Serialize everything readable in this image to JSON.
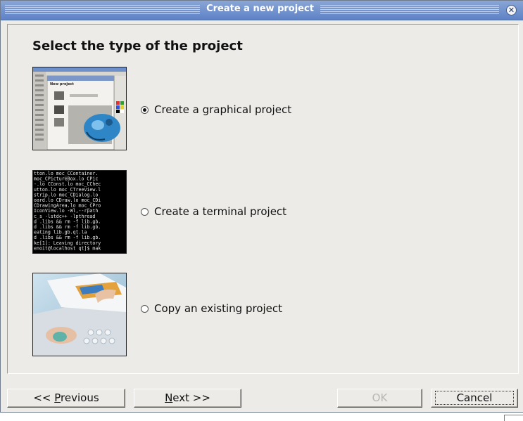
{
  "window": {
    "title": "Create a new project"
  },
  "heading": "Select the type of the project",
  "options": [
    {
      "label": "Create a graphical project",
      "selected": true,
      "icon": "graphical-project-thumbnail"
    },
    {
      "label": "Create a terminal project",
      "selected": false,
      "icon": "terminal-project-thumbnail"
    },
    {
      "label": "Copy an existing project",
      "selected": false,
      "icon": "copy-project-thumbnail"
    }
  ],
  "terminal_lines": [
    "tton.lo moc_CContainer.",
    " moc_CPictureBox.lo CPic",
    "-.lo CConst.lo moc_CChec",
    "utton.lo moc_CTreeView.l",
    "strip.lo moc_CDialog.lo ",
    "oard.lo CDraw.lo moc_CDi",
    "CDrawingArea.lo moc_CPro",
    "IconView.lo  -Wl,--rpath",
    "c_s -lstdc++ -lpthread  ",
    "d .libs && rm -f lib.gb.",
    "d .libs && rm -f lib.gb.",
    "eating lib.gb.qt.la",
    "d .libs && rm -f lib.gb.",
    "ke[1]: Leaving directory",
    "enoit@localhost qt]$ mak"
  ],
  "preview": {
    "caption": "New project",
    "subcaption": "Create a graphical project"
  },
  "buttons": {
    "previous": {
      "pre": "<< ",
      "key": "P",
      "post": "revious"
    },
    "next": {
      "pre": "",
      "key": "N",
      "post": "ext >>"
    },
    "ok": "OK",
    "cancel": "Cancel"
  },
  "colors": {
    "titlebar": "#5e82c6",
    "dialog_bg": "#ecebe8"
  }
}
